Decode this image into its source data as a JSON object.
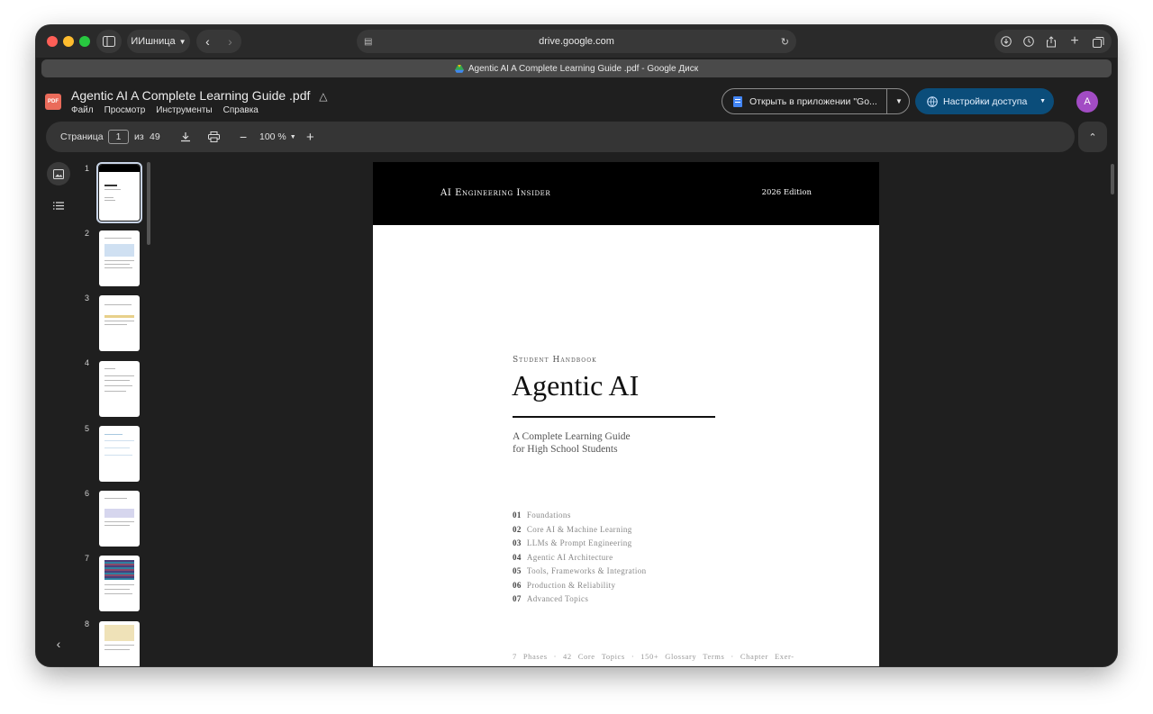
{
  "browser": {
    "profile_label": "ИИшница",
    "address": "drive.google.com",
    "tab_title": "Agentic AI A Complete Learning Guide .pdf - Google Диск"
  },
  "drive": {
    "file_title": "Agentic AI A Complete Learning Guide .pdf",
    "menu": [
      "Файл",
      "Просмотр",
      "Инструменты",
      "Справка"
    ],
    "open_in_app_label": "Открыть в приложении \"Go...",
    "share_label": "Настройки доступа",
    "avatar_letter": "A",
    "colors": {
      "share_bg": "#0b4d7a",
      "avatar_bg": "#a24cc4",
      "pdf_badge": "#ea6b5a"
    }
  },
  "toolbar": {
    "page_label": "Страница",
    "current_page": "1",
    "of_label": "из",
    "total_pages": "49",
    "zoom": "100 %"
  },
  "thumbnails": {
    "numbers": [
      "1",
      "2",
      "3",
      "4",
      "5",
      "6",
      "7",
      "8"
    ],
    "selected": "1"
  },
  "pdf_page": {
    "band_left": "AI Engineering Insider",
    "band_right": "2026 Edition",
    "kicker": "Student Handbook",
    "title": "Agentic AI",
    "subtitle_line1": "A Complete Learning Guide",
    "subtitle_line2": "for High School Students",
    "toc": [
      {
        "num": "01",
        "label": "Foundations"
      },
      {
        "num": "02",
        "label": "Core AI & Machine Learning"
      },
      {
        "num": "03",
        "label": "LLMs & Prompt Engineering"
      },
      {
        "num": "04",
        "label": "Agentic AI Architecture"
      },
      {
        "num": "05",
        "label": "Tools, Frameworks & Integration"
      },
      {
        "num": "06",
        "label": "Production & Reliability"
      },
      {
        "num": "07",
        "label": "Advanced Topics"
      }
    ],
    "footer": [
      "7",
      "Phases",
      "·",
      "42",
      "Core",
      "Topics",
      "·",
      "150+",
      "Glossary",
      "Terms",
      "·",
      "Chapter",
      "Exer-"
    ]
  }
}
